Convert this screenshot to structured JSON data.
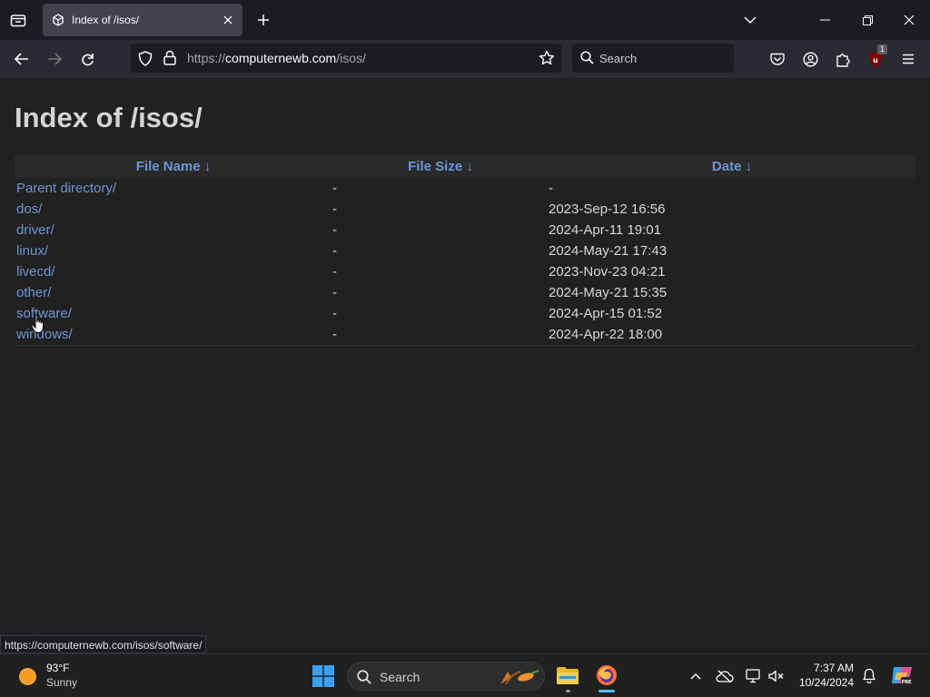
{
  "browser": {
    "tab_title": "Index of /isos/",
    "url_prefix": "https://",
    "url_domain": "computernewb.com",
    "url_path": "/isos/",
    "search_placeholder": "Search",
    "extension_badge": "1"
  },
  "page": {
    "heading": "Index of /isos/",
    "columns": {
      "name": "File Name  ↓",
      "size": "File Size  ↓",
      "date": "Date  ↓"
    },
    "rows": [
      {
        "name": "Parent directory/",
        "size": "-",
        "date": "-"
      },
      {
        "name": "dos/",
        "size": "-",
        "date": "2023-Sep-12 16:56"
      },
      {
        "name": "driver/",
        "size": "-",
        "date": "2024-Apr-11 19:01"
      },
      {
        "name": "linux/",
        "size": "-",
        "date": "2024-May-21 17:43"
      },
      {
        "name": "livecd/",
        "size": "-",
        "date": "2023-Nov-23 04:21"
      },
      {
        "name": "other/",
        "size": "-",
        "date": "2024-May-21 15:35"
      },
      {
        "name": "software/",
        "size": "-",
        "date": "2024-Apr-15 01:52"
      },
      {
        "name": "windows/",
        "size": "-",
        "date": "2024-Apr-22 18:00"
      }
    ]
  },
  "status_url": "https://computernewb.com/isos/software/",
  "taskbar": {
    "weather_temp": "93°F",
    "weather_condition": "Sunny",
    "search_placeholder": "Search",
    "time": "7:37 AM",
    "date": "10/24/2024"
  },
  "colors": {
    "link": "#6d95d6",
    "page_bg": "#212121",
    "toolbar_bg": "#2b2a33"
  }
}
